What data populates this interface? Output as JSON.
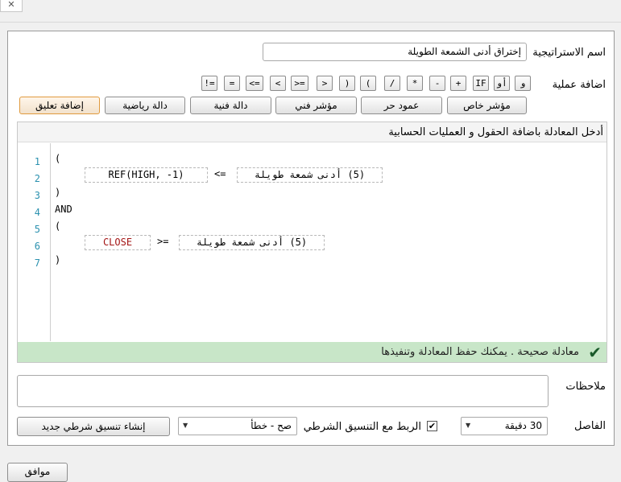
{
  "window": {
    "close_glyph": "✕"
  },
  "strategy": {
    "name_label": "اسم الاستراتيجية",
    "name_value": "إختراق أدنى الشمعة الطويلة"
  },
  "operators": {
    "label": "اضافة عملية",
    "items": [
      "و",
      "أو",
      "IF",
      "+",
      "-",
      "*",
      "/",
      "(",
      ")",
      ">",
      ">=",
      "<",
      "<=",
      "=",
      "!="
    ]
  },
  "buttons": {
    "special_indicator": "مؤشر خاص",
    "free_column": "عمود حر",
    "tech_indicator": "مؤشر فني",
    "tech_function": "دالة فنية",
    "math_function": "دالة رياضية",
    "add_comment": "إضافة تعليق"
  },
  "editor": {
    "header": "أدخل المعادلة باضافة الحقول و العمليات الحسابية",
    "line_numbers": [
      "1",
      "2",
      "3",
      "4",
      "5",
      "6",
      "7"
    ],
    "line1": "(",
    "line2_field1": "REF(HIGH, -1)",
    "line2_op": "<=",
    "line2_field2": "(5) أدنى شمعة طويلة",
    "line3": ")",
    "line4": "AND",
    "line5": "(",
    "line6_field1": "CLOSE",
    "line6_op": ">=",
    "line6_field2": "(5) أدنى شمعة طويلة",
    "line7": ")",
    "status": "معادلة صحيحة . يمكنك حفظ المعادلة وتنفيذها",
    "status_color": "#c8e6c8"
  },
  "notes": {
    "label": "ملاحظات",
    "value": ""
  },
  "interval": {
    "label": "الفاصل",
    "value": "30 دقيقة"
  },
  "conditional": {
    "link_label": "الربط مع التنسيق الشرطي",
    "link_checked": true,
    "select_value": "صح - خطأ",
    "create_button": "إنشاء تنسيق شرطي جديد"
  },
  "footer": {
    "ok_button": "موافق"
  }
}
